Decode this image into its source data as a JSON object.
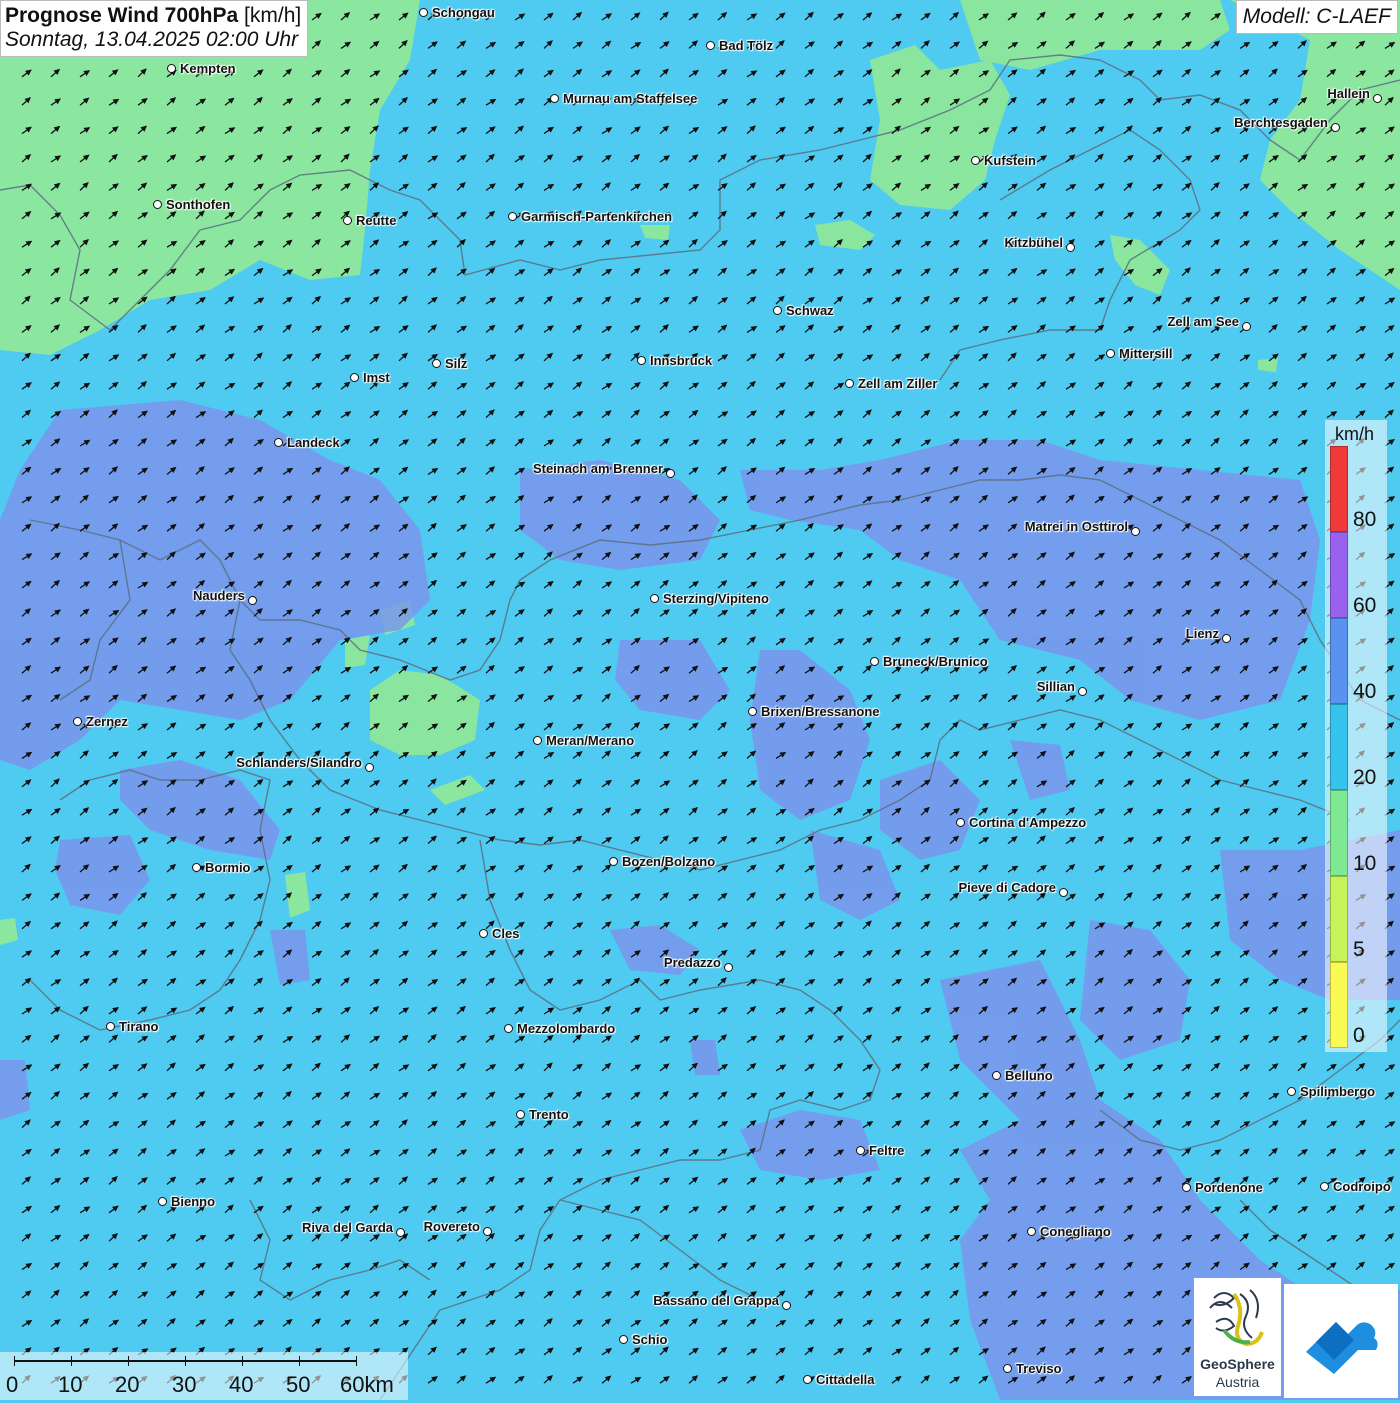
{
  "header": {
    "title_bold": "Prognose Wind 700hPa",
    "title_unit": "[km/h]",
    "subtitle": "Sonntag, 13.04.2025 02:00 Uhr",
    "model": "Modell: C-LAEF"
  },
  "legend": {
    "unit": "km/h",
    "ticks": [
      "80",
      "60",
      "40",
      "20",
      "10",
      "5",
      "0"
    ],
    "colors": [
      "#f03a3a",
      "#9a60ee",
      "#5a92f0",
      "#34c4ee",
      "#7ee892",
      "#c6f25a",
      "#fafa55"
    ]
  },
  "scale_bar": {
    "labels": [
      "0",
      "10",
      "20",
      "30",
      "40",
      "50",
      "60km"
    ]
  },
  "logos": {
    "geosphere_name": "GeoSphere",
    "geosphere_sub": "Austria"
  },
  "cities": [
    {
      "name": "Schongau",
      "label_side": "right"
    },
    {
      "name": "Bad Tölz",
      "label_side": "right"
    },
    {
      "name": "Kempten",
      "label_side": "right"
    },
    {
      "name": "Murnau am Staffelsee",
      "label_side": "right"
    },
    {
      "name": "Hallein",
      "label_side": "left"
    },
    {
      "name": "Berchtesgaden",
      "label_side": "left"
    },
    {
      "name": "Kufstein",
      "label_side": "right"
    },
    {
      "name": "Sonthofen",
      "label_side": "right"
    },
    {
      "name": "Reutte",
      "label_side": "right"
    },
    {
      "name": "Garmisch-Partenkirchen",
      "label_side": "right"
    },
    {
      "name": "Kitzbühel",
      "label_side": "left"
    },
    {
      "name": "Schwaz",
      "label_side": "right"
    },
    {
      "name": "Zell am See",
      "label_side": "left"
    },
    {
      "name": "Mittersill",
      "label_side": "right"
    },
    {
      "name": "Innsbruck",
      "label_side": "right"
    },
    {
      "name": "Silz",
      "label_side": "right"
    },
    {
      "name": "Imst",
      "label_side": "right"
    },
    {
      "name": "Zell am Ziller",
      "label_side": "right"
    },
    {
      "name": "Landeck",
      "label_side": "right"
    },
    {
      "name": "Steinach am Brenner",
      "label_side": "left"
    },
    {
      "name": "Matrei in Osttirol",
      "label_side": "left"
    },
    {
      "name": "Nauders",
      "label_side": "left"
    },
    {
      "name": "Sterzing/Vipiteno",
      "label_side": "right"
    },
    {
      "name": "Lienz",
      "label_side": "left"
    },
    {
      "name": "Bruneck/Brunico",
      "label_side": "right"
    },
    {
      "name": "Sillian",
      "label_side": "left"
    },
    {
      "name": "Brixen/Bressanone",
      "label_side": "right"
    },
    {
      "name": "Zernez",
      "label_side": "right"
    },
    {
      "name": "Meran/Merano",
      "label_side": "right"
    },
    {
      "name": "Schlanders/Silandro",
      "label_side": "left"
    },
    {
      "name": "Cortina d'Ampezzo",
      "label_side": "right"
    },
    {
      "name": "Bozen/Bolzano",
      "label_side": "right"
    },
    {
      "name": "Bormio",
      "label_side": "right"
    },
    {
      "name": "Pieve di Cadore",
      "label_side": "left"
    },
    {
      "name": "Cles",
      "label_side": "right"
    },
    {
      "name": "Predazzo",
      "label_side": "left"
    },
    {
      "name": "Tirano",
      "label_side": "right"
    },
    {
      "name": "Mezzolombardo",
      "label_side": "right"
    },
    {
      "name": "Belluno",
      "label_side": "right"
    },
    {
      "name": "Spilimbergo",
      "label_side": "right"
    },
    {
      "name": "Trento",
      "label_side": "right"
    },
    {
      "name": "Feltre",
      "label_side": "right"
    },
    {
      "name": "Pordenone",
      "label_side": "right"
    },
    {
      "name": "Codroipo",
      "label_side": "right"
    },
    {
      "name": "Bienno",
      "label_side": "right"
    },
    {
      "name": "Riva del Garda",
      "label_side": "left"
    },
    {
      "name": "Rovereto",
      "label_side": "left"
    },
    {
      "name": "Conegliano",
      "label_side": "right"
    },
    {
      "name": "Bassano del Grappa",
      "label_side": "left"
    },
    {
      "name": "Schio",
      "label_side": "right"
    },
    {
      "name": "Treviso",
      "label_side": "right"
    },
    {
      "name": "Cittadella",
      "label_side": "right"
    }
  ],
  "wind_direction": "from southwest (arrows pointing northeast)",
  "colors": {
    "band_10_20": "#4fcaf0",
    "band_5_10": "#8ee89a",
    "band_20_40": "#7a96ec"
  }
}
